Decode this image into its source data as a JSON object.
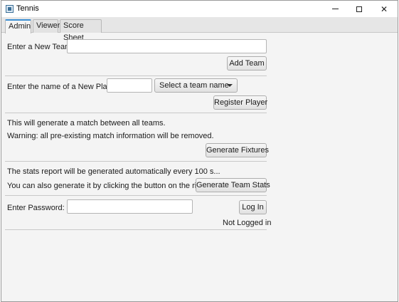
{
  "window": {
    "title": "Tennis",
    "minimize_icon": "minimize-icon",
    "maximize_icon": "maximize-icon",
    "close_icon": "close-icon",
    "close_glyph": "✕"
  },
  "tabs": [
    {
      "label": "Admin",
      "active": true
    },
    {
      "label": "Viewer",
      "active": false
    },
    {
      "label": "Score Sheet",
      "active": false
    }
  ],
  "new_team": {
    "label": "Enter a New Team:",
    "value": "",
    "button": "Add Team"
  },
  "new_player": {
    "label": "Enter the name of a New Player:",
    "value": "",
    "team_select": "Select a team name",
    "button": "Register Player"
  },
  "fixtures": {
    "info": "This will generate a match between all teams.",
    "warning": "Warning: all pre-existing match information will be removed.",
    "button": "Generate Fixtures"
  },
  "stats": {
    "info": "The stats report will be generated automatically every 100 s...",
    "manual": "You can also generate it by clicking the button on the right.",
    "button": "Generate Team Stats"
  },
  "login": {
    "label": "Enter Password:",
    "value": "",
    "button": "Log In",
    "status": "Not Logged in"
  },
  "colors": {
    "accent": "#3c8fd3",
    "background": "#f4f4f4"
  }
}
